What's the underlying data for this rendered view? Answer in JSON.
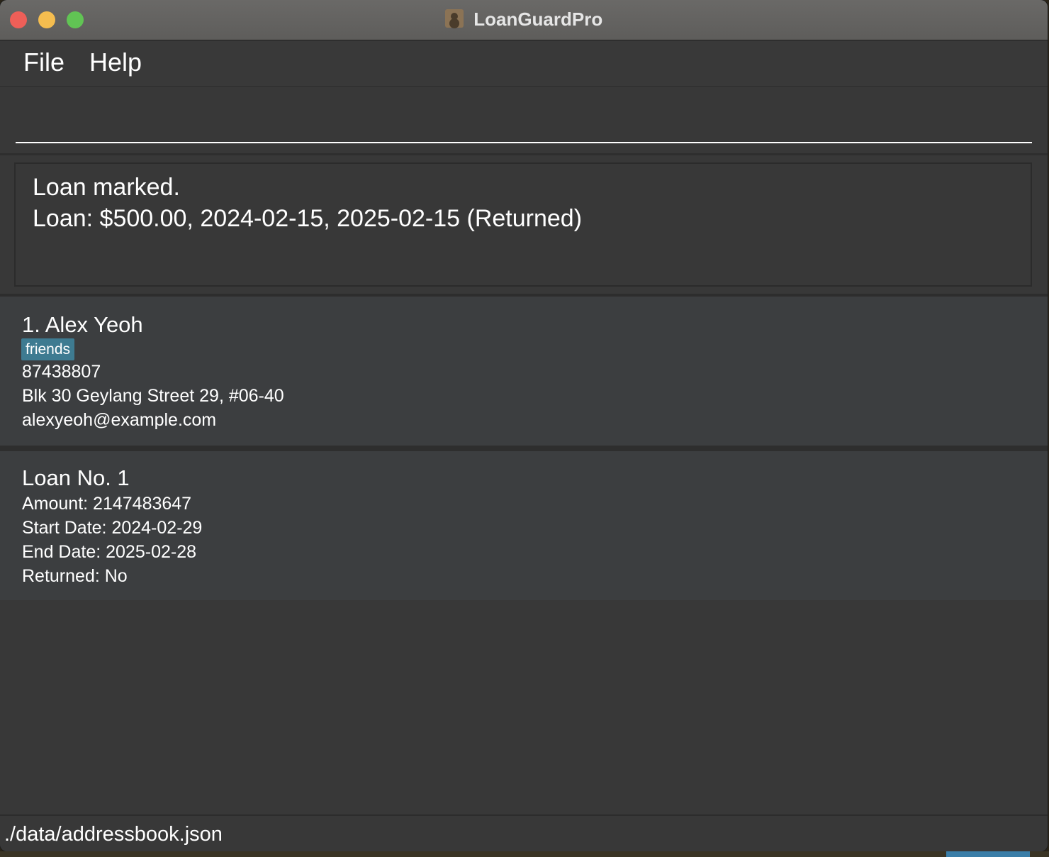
{
  "window": {
    "title": "LoanGuardPro"
  },
  "menu": {
    "file": "File",
    "help": "Help"
  },
  "command": {
    "value": "",
    "placeholder": ""
  },
  "result": {
    "line1": "Loan marked.",
    "line2": "Loan: $500.00, 2024-02-15, 2025-02-15 (Returned)"
  },
  "person": {
    "index_name": "1.  Alex Yeoh",
    "tags": [
      "friends"
    ],
    "phone": "87438807",
    "address": "Blk 30 Geylang Street 29, #06-40",
    "email": "alexyeoh@example.com"
  },
  "loan": {
    "title": "Loan No. 1",
    "amount": "Amount: 2147483647",
    "start_date": "Start Date: 2024-02-29",
    "end_date": "End Date: 2025-02-28",
    "returned": "Returned: No"
  },
  "status": {
    "path": "./data/addressbook.json"
  },
  "colors": {
    "window_bg": "#383838",
    "card_bg": "#3c3e40",
    "tag_bg": "#3e7b91",
    "close": "#ee5f58",
    "minimize": "#f5bd4f",
    "maximize": "#61c454"
  }
}
